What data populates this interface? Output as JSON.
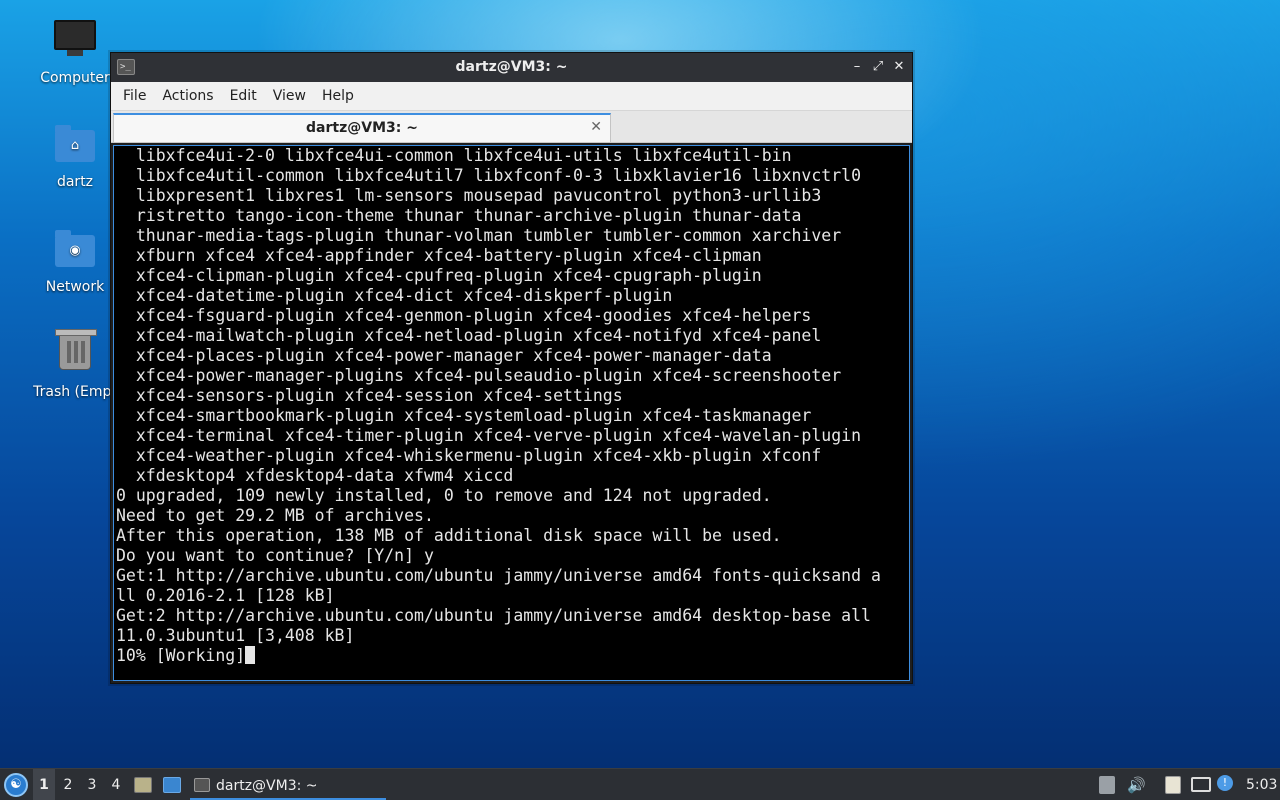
{
  "desktop": {
    "icons": [
      {
        "label": "Computer",
        "icon": "computer-icon"
      },
      {
        "label": "dartz",
        "icon": "home-folder-icon"
      },
      {
        "label": "Network",
        "icon": "network-folder-icon"
      },
      {
        "label": "Trash (Empt",
        "icon": "trash-icon"
      }
    ]
  },
  "window": {
    "title": "dartz@VM3: ~",
    "menu": [
      "File",
      "Actions",
      "Edit",
      "View",
      "Help"
    ],
    "tab_label": "dartz@VM3: ~",
    "controls": {
      "minimize": "–",
      "maximize": "⤢",
      "close": "✕"
    },
    "terminal_lines": [
      "  libxfce4ui-2-0 libxfce4ui-common libxfce4ui-utils libxfce4util-bin",
      "  libxfce4util-common libxfce4util7 libxfconf-0-3 libxklavier16 libxnvctrl0",
      "  libxpresent1 libxres1 lm-sensors mousepad pavucontrol python3-urllib3",
      "  ristretto tango-icon-theme thunar thunar-archive-plugin thunar-data",
      "  thunar-media-tags-plugin thunar-volman tumbler tumbler-common xarchiver",
      "  xfburn xfce4 xfce4-appfinder xfce4-battery-plugin xfce4-clipman",
      "  xfce4-clipman-plugin xfce4-cpufreq-plugin xfce4-cpugraph-plugin",
      "  xfce4-datetime-plugin xfce4-dict xfce4-diskperf-plugin",
      "  xfce4-fsguard-plugin xfce4-genmon-plugin xfce4-goodies xfce4-helpers",
      "  xfce4-mailwatch-plugin xfce4-netload-plugin xfce4-notifyd xfce4-panel",
      "  xfce4-places-plugin xfce4-power-manager xfce4-power-manager-data",
      "  xfce4-power-manager-plugins xfce4-pulseaudio-plugin xfce4-screenshooter",
      "  xfce4-sensors-plugin xfce4-session xfce4-settings",
      "  xfce4-smartbookmark-plugin xfce4-systemload-plugin xfce4-taskmanager",
      "  xfce4-terminal xfce4-timer-plugin xfce4-verve-plugin xfce4-wavelan-plugin",
      "  xfce4-weather-plugin xfce4-whiskermenu-plugin xfce4-xkb-plugin xfconf",
      "  xfdesktop4 xfdesktop4-data xfwm4 xiccd",
      "0 upgraded, 109 newly installed, 0 to remove and 124 not upgraded.",
      "Need to get 29.2 MB of archives.",
      "After this operation, 138 MB of additional disk space will be used.",
      "Do you want to continue? [Y/n] y",
      "Get:1 http://archive.ubuntu.com/ubuntu jammy/universe amd64 fonts-quicksand a",
      "ll 0.2016-2.1 [128 kB]",
      "Get:2 http://archive.ubuntu.com/ubuntu jammy/universe amd64 desktop-base all",
      "11.0.3ubuntu1 [3,408 kB]"
    ],
    "prompt_line": "10% [Working]"
  },
  "taskbar": {
    "workspaces": [
      "1",
      "2",
      "3",
      "4"
    ],
    "active_workspace": "1",
    "task_label": "dartz@VM3: ~",
    "clock": "5:03"
  }
}
